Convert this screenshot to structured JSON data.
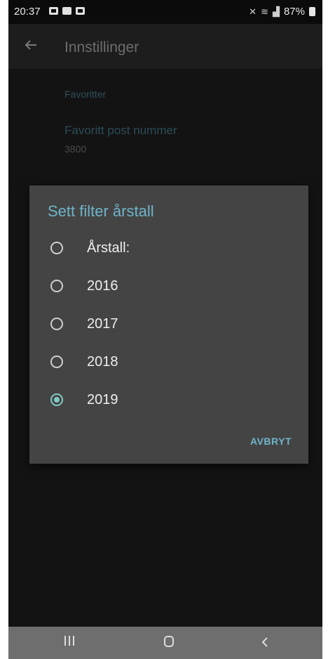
{
  "status_bar": {
    "time": "20:37",
    "right_text": "87%",
    "icons": [
      "image-icon",
      "notification-icon",
      "notification-icon",
      "vibrate-icon",
      "wifi-icon",
      "signal-icon",
      "battery-icon"
    ]
  },
  "toolbar": {
    "title": "Innstillinger",
    "back_icon": "arrow-left-icon"
  },
  "settings": {
    "section_header": "Favoritter",
    "favorite_post": {
      "title": "Favoritt post nummer",
      "summary": "3800"
    }
  },
  "dialog": {
    "title": "Sett filter årstall",
    "options": [
      {
        "label": "Årstall:",
        "checked": false
      },
      {
        "label": "2016",
        "checked": false
      },
      {
        "label": "2017",
        "checked": false
      },
      {
        "label": "2018",
        "checked": false
      },
      {
        "label": "2019",
        "checked": true
      }
    ],
    "cancel_label": "AVBRYT"
  },
  "nav_bar": {
    "icons": [
      "recent-apps-icon",
      "home-icon",
      "back-icon"
    ]
  },
  "colors": {
    "accent": "#80cbc4",
    "dialog_title": "#6fb4c9",
    "dialog_bg": "#444444"
  }
}
